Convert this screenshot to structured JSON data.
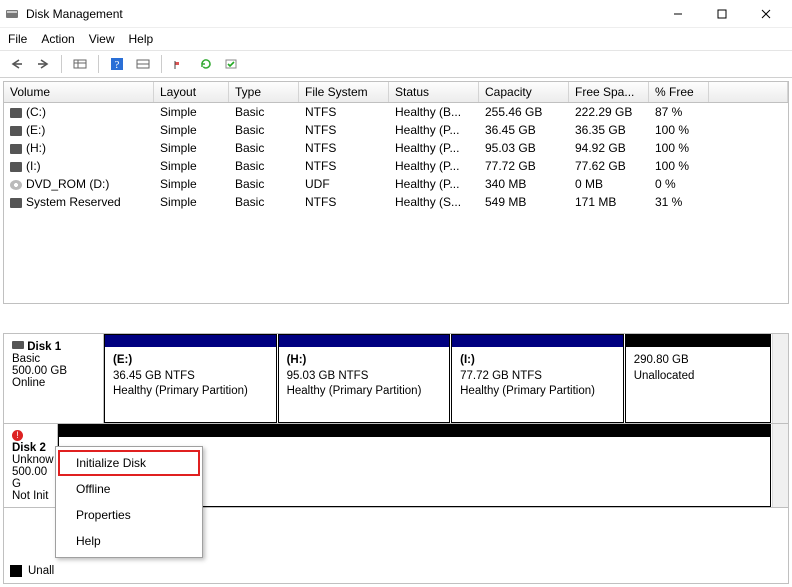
{
  "window": {
    "title": "Disk Management"
  },
  "menu": {
    "file": "File",
    "action": "Action",
    "view": "View",
    "help": "Help"
  },
  "columns": {
    "c0": "Volume",
    "c1": "Layout",
    "c2": "Type",
    "c3": "File System",
    "c4": "Status",
    "c5": "Capacity",
    "c6": "Free Spa...",
    "c7": "% Free"
  },
  "volumes": [
    {
      "name": "(C:)",
      "layout": "Simple",
      "type": "Basic",
      "fs": "NTFS",
      "status": "Healthy (B...",
      "cap": "255.46 GB",
      "free": "222.29 GB",
      "pct": "87 %",
      "icon": "hdd"
    },
    {
      "name": "(E:)",
      "layout": "Simple",
      "type": "Basic",
      "fs": "NTFS",
      "status": "Healthy (P...",
      "cap": "36.45 GB",
      "free": "36.35 GB",
      "pct": "100 %",
      "icon": "hdd"
    },
    {
      "name": "(H:)",
      "layout": "Simple",
      "type": "Basic",
      "fs": "NTFS",
      "status": "Healthy (P...",
      "cap": "95.03 GB",
      "free": "94.92 GB",
      "pct": "100 %",
      "icon": "hdd"
    },
    {
      "name": "(I:)",
      "layout": "Simple",
      "type": "Basic",
      "fs": "NTFS",
      "status": "Healthy (P...",
      "cap": "77.72 GB",
      "free": "77.62 GB",
      "pct": "100 %",
      "icon": "hdd"
    },
    {
      "name": "DVD_ROM (D:)",
      "layout": "Simple",
      "type": "Basic",
      "fs": "UDF",
      "status": "Healthy (P...",
      "cap": "340 MB",
      "free": "0 MB",
      "pct": "0 %",
      "icon": "cd"
    },
    {
      "name": "System Reserved",
      "layout": "Simple",
      "type": "Basic",
      "fs": "NTFS",
      "status": "Healthy (S...",
      "cap": "549 MB",
      "free": "171 MB",
      "pct": "31 %",
      "icon": "hdd"
    }
  ],
  "disk1": {
    "name": "Disk 1",
    "type": "Basic",
    "size": "500.00 GB",
    "status": "Online",
    "parts": [
      {
        "label": "(E:)",
        "line2": "36.45 GB NTFS",
        "line3": "Healthy (Primary Partition)",
        "bar": "blue",
        "flex": "1.3"
      },
      {
        "label": "(H:)",
        "line2": "95.03 GB NTFS",
        "line3": "Healthy (Primary Partition)",
        "bar": "blue",
        "flex": "1.3"
      },
      {
        "label": "(I:)",
        "line2": "77.72 GB NTFS",
        "line3": "Healthy (Primary Partition)",
        "bar": "blue",
        "flex": "1.3"
      },
      {
        "label": "",
        "line2": "290.80 GB",
        "line3": "Unallocated",
        "bar": "black",
        "flex": "1.1"
      }
    ]
  },
  "disk2": {
    "name": "Disk 2",
    "type": "Unknow",
    "size": "500.00 G",
    "status": "Not Init"
  },
  "context_menu": {
    "initialize": "Initialize Disk",
    "offline": "Offline",
    "properties": "Properties",
    "help": "Help"
  },
  "legend": {
    "unallocated": "Unall"
  }
}
